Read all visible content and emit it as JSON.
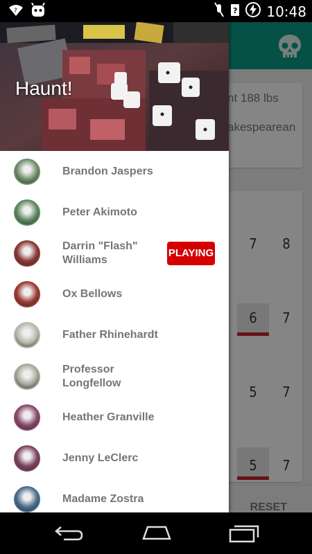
{
  "status_bar": {
    "time": "10:48"
  },
  "background": {
    "card1_line1": "nt 188 lbs",
    "card1_line2": "akespearean",
    "numbers": [
      "7",
      "8",
      "6",
      "7",
      "5",
      "7",
      "5",
      "7"
    ],
    "reset_label": "RESET"
  },
  "drawer": {
    "header_title": "Haunt!",
    "characters": [
      {
        "name": "Brandon Jaspers",
        "avatar_color": "#6f8f6a"
      },
      {
        "name": "Peter Akimoto",
        "avatar_color": "#5f8a60"
      },
      {
        "name": "Darrin \"Flash\" Williams",
        "avatar_color": "#8b3a36",
        "badge": "PLAYING"
      },
      {
        "name": "Ox Bellows",
        "avatar_color": "#9c3b35"
      },
      {
        "name": "Father Rhinehardt",
        "avatar_color": "#b8b8ad"
      },
      {
        "name": "Professor Longfellow",
        "avatar_color": "#a9a89a"
      },
      {
        "name": "Heather Granville",
        "avatar_color": "#8a4b6a"
      },
      {
        "name": "Jenny LeClerc",
        "avatar_color": "#7e465f"
      },
      {
        "name": "Madame Zostra",
        "avatar_color": "#4d6f8c"
      }
    ]
  },
  "colors": {
    "toolbar": "#0b9c87",
    "badge": "#d50000",
    "accent_bar": "#c62828"
  }
}
